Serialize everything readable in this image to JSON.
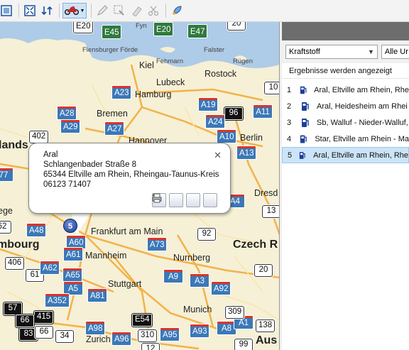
{
  "toolbar": {
    "buttons": [
      "zoom-extent-icon",
      "swap-icon",
      "motorbike-icon",
      "dropdown-icon",
      "pencil-icon",
      "select-area-icon",
      "eraser-icon",
      "scissors-icon",
      "rocket-icon"
    ]
  },
  "map": {
    "cities": [
      {
        "name": "Kiel"
      },
      {
        "name": "Lubeck"
      },
      {
        "name": "Rostock"
      },
      {
        "name": "Hamburg"
      },
      {
        "name": "Bremen"
      },
      {
        "name": "Hannover"
      },
      {
        "name": "Berlin"
      },
      {
        "name": "Dresd"
      },
      {
        "name": "Frankfurt am Main"
      },
      {
        "name": "Mannheim"
      },
      {
        "name": "Nurnberg"
      },
      {
        "name": "Stuttgart"
      },
      {
        "name": "Munich"
      },
      {
        "name": "Zurich"
      },
      {
        "name": "Czech R"
      },
      {
        "name": "lands"
      },
      {
        "name": "mbourg"
      },
      {
        "name": "ege"
      },
      {
        "name": "Aus"
      }
    ],
    "small_labels": [
      {
        "name": "Flensburger Förde"
      },
      {
        "name": "Fehmarn"
      },
      {
        "name": "Falster"
      },
      {
        "name": "Rügen"
      },
      {
        "name": "Fyn"
      }
    ],
    "shields": [
      {
        "label": "E20"
      },
      {
        "label": "E45"
      },
      {
        "label": "E20"
      },
      {
        "label": "E47"
      },
      {
        "label": "20"
      },
      {
        "label": "A23"
      },
      {
        "label": "A19"
      },
      {
        "label": "96"
      },
      {
        "label": "A11"
      },
      {
        "label": "10"
      },
      {
        "label": "A28"
      },
      {
        "label": "A29"
      },
      {
        "label": "A27"
      },
      {
        "label": "A24"
      },
      {
        "label": "A10"
      },
      {
        "label": "A13"
      },
      {
        "label": "402"
      },
      {
        "label": "77"
      },
      {
        "label": "A4"
      },
      {
        "label": "13"
      },
      {
        "label": "A48"
      },
      {
        "label": "62"
      },
      {
        "label": "A60"
      },
      {
        "label": "92"
      },
      {
        "label": "A73"
      },
      {
        "label": "406"
      },
      {
        "label": "61"
      },
      {
        "label": "A62"
      },
      {
        "label": "A61"
      },
      {
        "label": "A65"
      },
      {
        "label": "A9"
      },
      {
        "label": "A3"
      },
      {
        "label": "A92"
      },
      {
        "label": "20"
      },
      {
        "label": "A5"
      },
      {
        "label": "A81"
      },
      {
        "label": "A352"
      },
      {
        "label": "57"
      },
      {
        "label": "415"
      },
      {
        "label": "66"
      },
      {
        "label": "83"
      },
      {
        "label": "66"
      },
      {
        "label": "34"
      },
      {
        "label": "A98"
      },
      {
        "label": "E54"
      },
      {
        "label": "310"
      },
      {
        "label": "A95"
      },
      {
        "label": "A93"
      },
      {
        "label": "A8"
      },
      {
        "label": "A1"
      },
      {
        "label": "309"
      },
      {
        "label": "138"
      },
      {
        "label": "99"
      },
      {
        "label": "A96"
      },
      {
        "label": "12"
      }
    ],
    "popup": {
      "name": "Aral",
      "street": "Schlangenbader Straße 8",
      "city": "65344 Eltville am Rhein, Rheingau-Taunus-Kreis",
      "phone": "06123 71407",
      "buttons": [
        "navigate-icon",
        "route-from-icon",
        "route-add-icon",
        "print-icon"
      ]
    },
    "marker_label": "5"
  },
  "panel": {
    "filter_select": "Kraftstoff",
    "second_select": "Alle Ur",
    "status": "Ergebnisse werden angezeigt",
    "results": [
      {
        "num": "1",
        "text": "Aral, Eltville am Rhein, Rhe"
      },
      {
        "num": "2",
        "text": "Aral, Heidesheim am Rhei"
      },
      {
        "num": "3",
        "text": "Sb, Walluf - Nieder-Walluf,"
      },
      {
        "num": "4",
        "text": "Star, Eltville am Rhein - Ma"
      },
      {
        "num": "5",
        "text": "Aral, Eltville am Rhein, Rhe"
      }
    ]
  },
  "colors": {
    "map_land": "#f6f0d6",
    "sea": "#aecbe8",
    "motorway_shield": "#3b78b8",
    "selected_row": "#cce4f7"
  }
}
